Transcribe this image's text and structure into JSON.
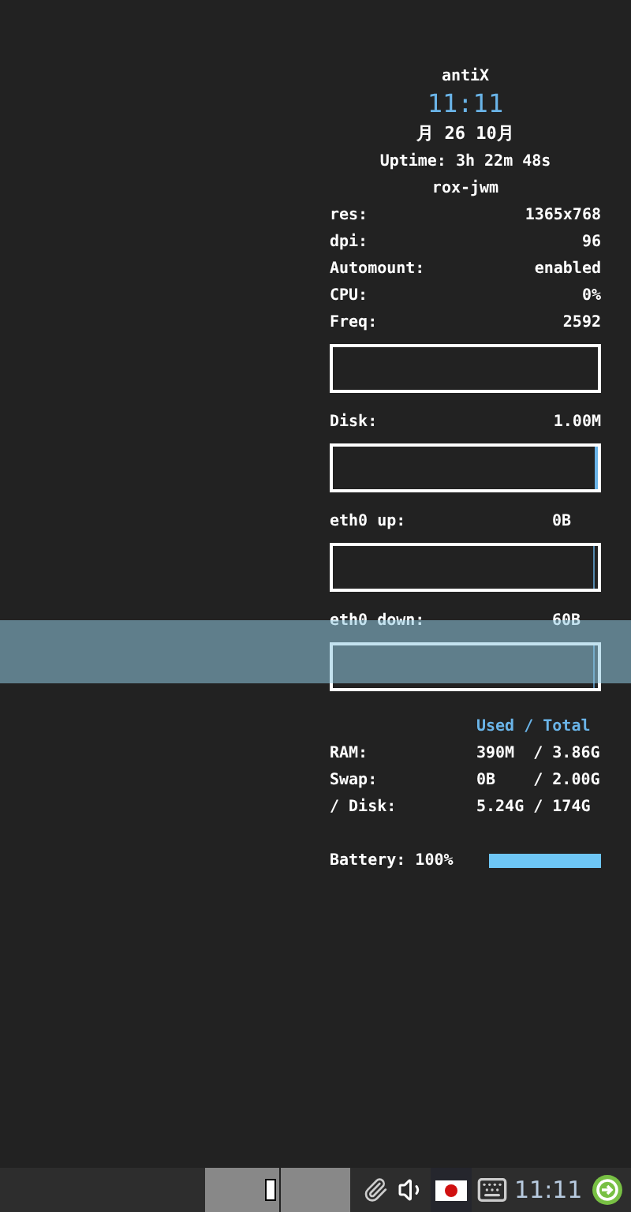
{
  "conky": {
    "title": "antiX",
    "clock": "11:11",
    "date": "月 26 10月",
    "uptime": "Uptime: 3h 22m 48s",
    "wm": "rox-jwm",
    "info": [
      {
        "label": "res:",
        "value": "1365x768"
      },
      {
        "label": "dpi:",
        "value": "96"
      },
      {
        "label": "Automount:",
        "value": "enabled"
      },
      {
        "label": "CPU:",
        "value": "0%"
      },
      {
        "label": "Freq:",
        "value": "2592"
      }
    ],
    "graphs": [
      {
        "kind": "right",
        "label": "Disk:",
        "value": "1.00M"
      },
      {
        "kind": "column",
        "label": "eth0 up:",
        "value": "0B"
      },
      {
        "kind": "column",
        "label": "eth0 down:",
        "value": "60B"
      }
    ],
    "memory": {
      "header": "Used / Total",
      "rows": [
        {
          "label": "RAM:",
          "value": "390M  / 3.86G"
        },
        {
          "label": "Swap:",
          "value": "0B    / 2.00G"
        },
        {
          "label": "/ Disk:",
          "value": "5.24G / 174G"
        }
      ]
    },
    "battery": {
      "label": "Battery: 100%",
      "level": 1
    }
  },
  "taskbar": {
    "clock": "11:11"
  }
}
